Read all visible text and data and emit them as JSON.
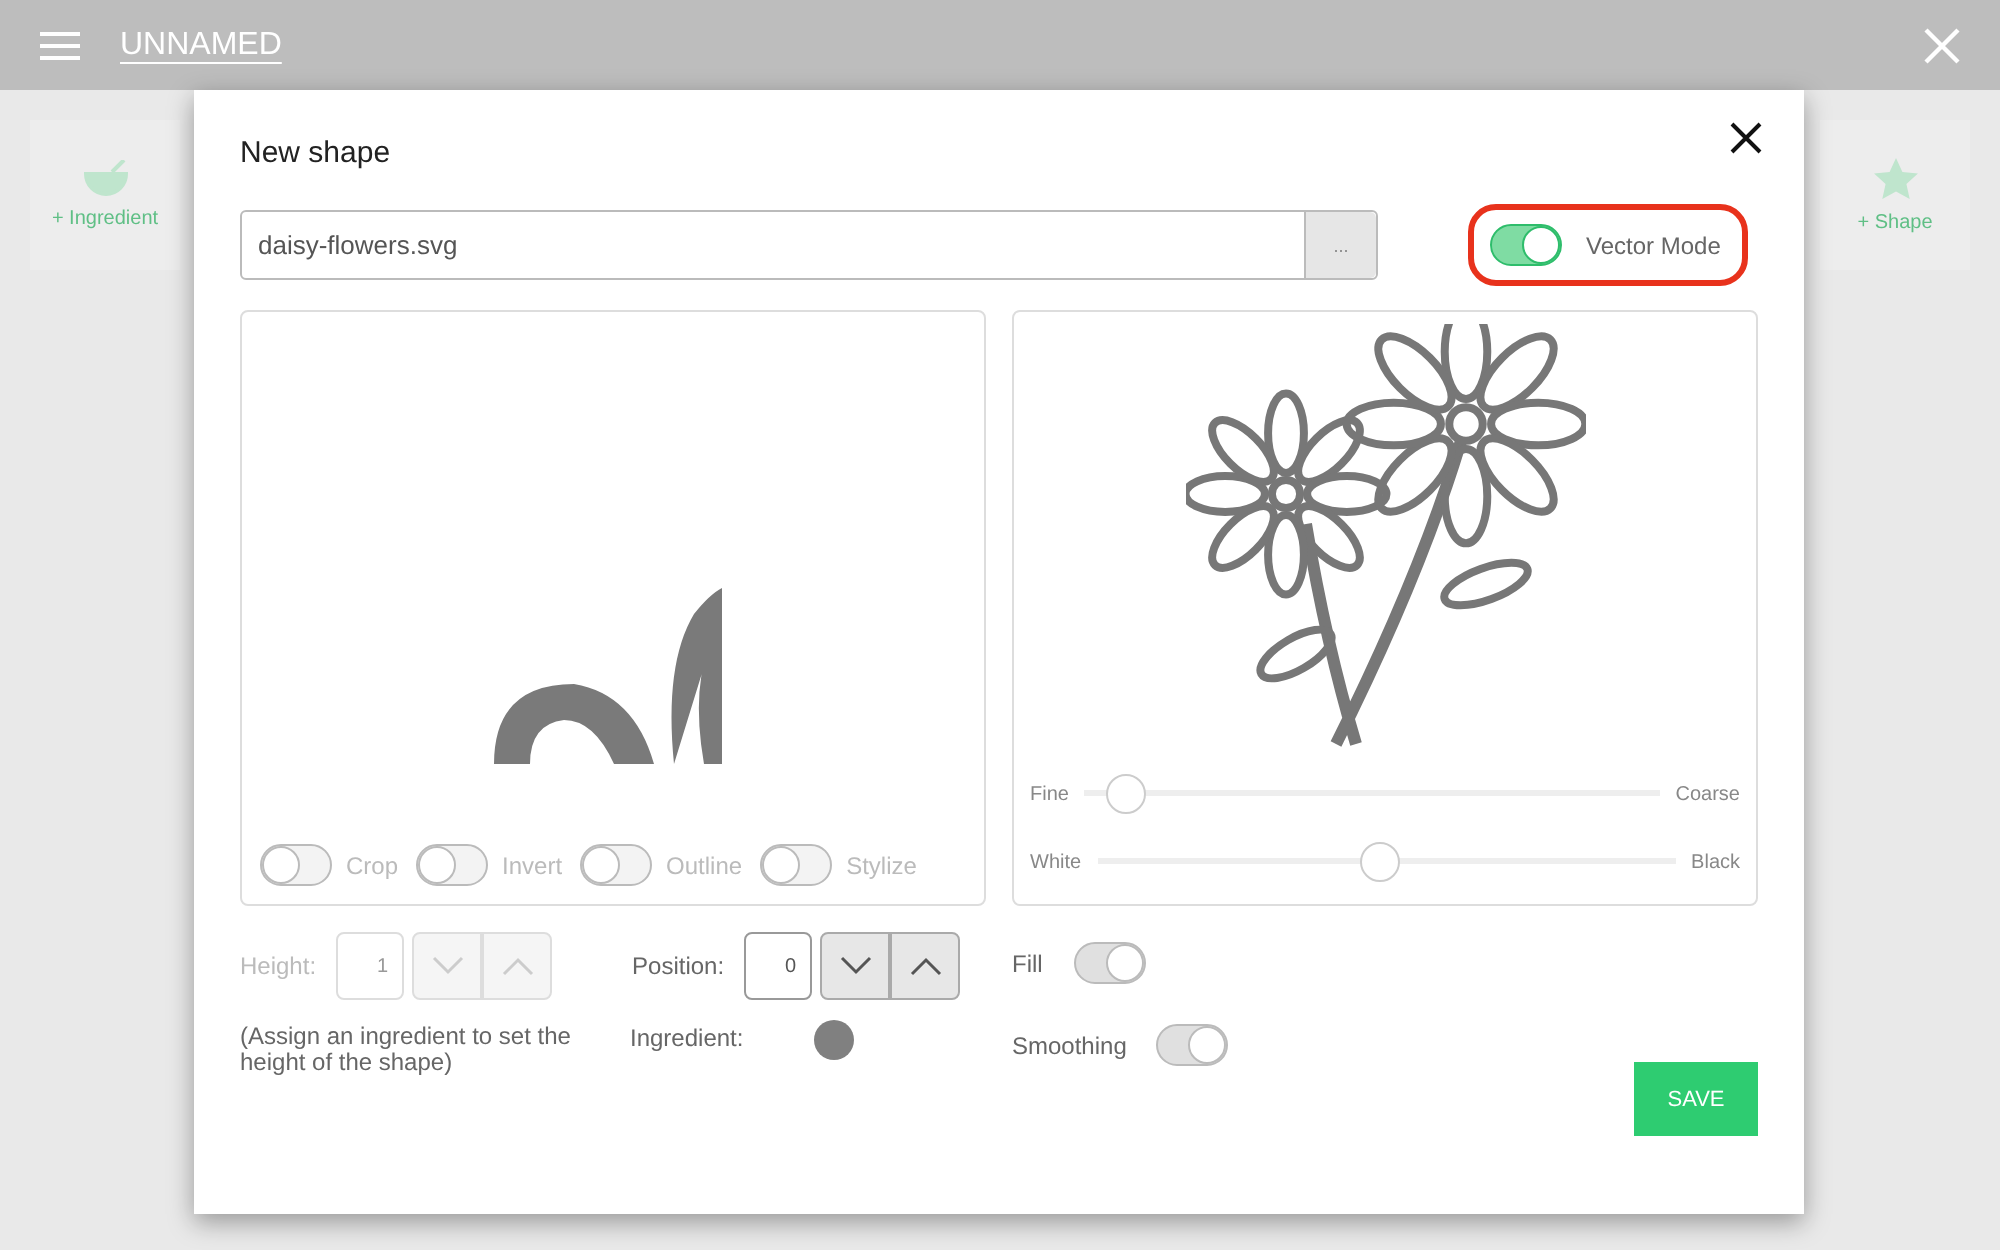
{
  "app_bar": {
    "title": "UNNAMED"
  },
  "background_cards": [
    {
      "label": "+ Ingredient",
      "kind": "ingredient"
    },
    {
      "label": "+ Shape",
      "kind": "shape"
    }
  ],
  "dialog": {
    "title": "New shape",
    "file": {
      "value": "daisy-flowers.svg",
      "browse_label": "..."
    },
    "vector_mode": {
      "label": "Vector Mode",
      "on": true,
      "highlighted": true
    },
    "image_toggles": [
      {
        "label": "Crop",
        "on": false
      },
      {
        "label": "Invert",
        "on": false
      },
      {
        "label": "Outline",
        "on": false
      },
      {
        "label": "Stylize",
        "on": false
      }
    ],
    "sliders": [
      {
        "min_label": "Fine",
        "max_label": "Coarse",
        "level": 0.07
      },
      {
        "min_label": "White",
        "max_label": "Black",
        "level": 0.49
      }
    ],
    "height": {
      "label": "Height:",
      "value": "1",
      "disabled": true
    },
    "position": {
      "label": "Position:",
      "value": "0",
      "disabled": false
    },
    "note": "(Assign an ingredient to set the height of the shape)",
    "ingredient": {
      "label": "Ingredient:",
      "color": "#808080"
    },
    "switches": [
      {
        "label": "Fill",
        "on": true
      },
      {
        "label": "Smoothing",
        "on": true
      }
    ],
    "save_label": "SAVE"
  }
}
